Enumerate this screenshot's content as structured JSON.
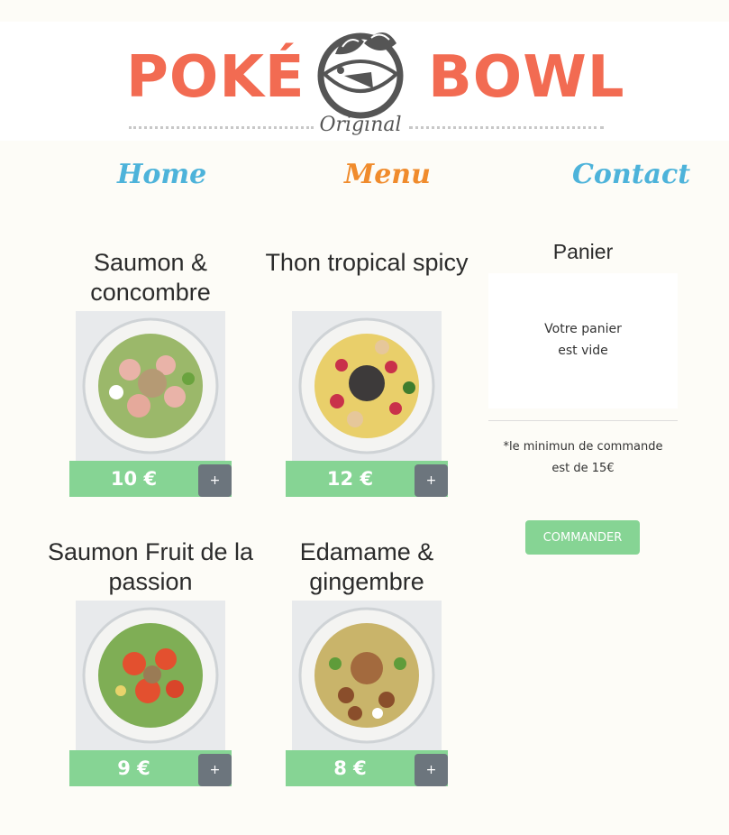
{
  "brand": {
    "word_left": "POKÉ",
    "word_right": "BOWL",
    "subtitle": "Original",
    "color": "#f26b52"
  },
  "nav": {
    "home": "Home",
    "menu": "Menu",
    "contact": "Contact",
    "active": "Menu"
  },
  "products": [
    {
      "title": "Saumon & concombre",
      "price": "10 €",
      "add_label": "+",
      "image_icon": "salmon-cucumber-bowl-image"
    },
    {
      "title": "Thon tropical spicy",
      "price": "12 €",
      "add_label": "+",
      "image_icon": "tropical-tuna-bowl-image"
    },
    {
      "title": "Saumon Fruit de la passion",
      "price": "9 €",
      "add_label": "+",
      "image_icon": "salmon-passion-bowl-image"
    },
    {
      "title": "Edamame & gingembre",
      "price": "8 €",
      "add_label": "+",
      "image_icon": "edamame-ginger-bowl-image"
    }
  ],
  "cart": {
    "title": "Panier",
    "empty_line1": "Votre panier",
    "empty_line2": "est vide",
    "note_line1": "*le minimun de commande",
    "note_line2": "est de 15€",
    "order_button": "COMMANDER"
  },
  "colors": {
    "price_bar": "#86d494",
    "add_button": "#6c757d",
    "nav_link": "#4db3da",
    "nav_active": "#f08b2c"
  }
}
